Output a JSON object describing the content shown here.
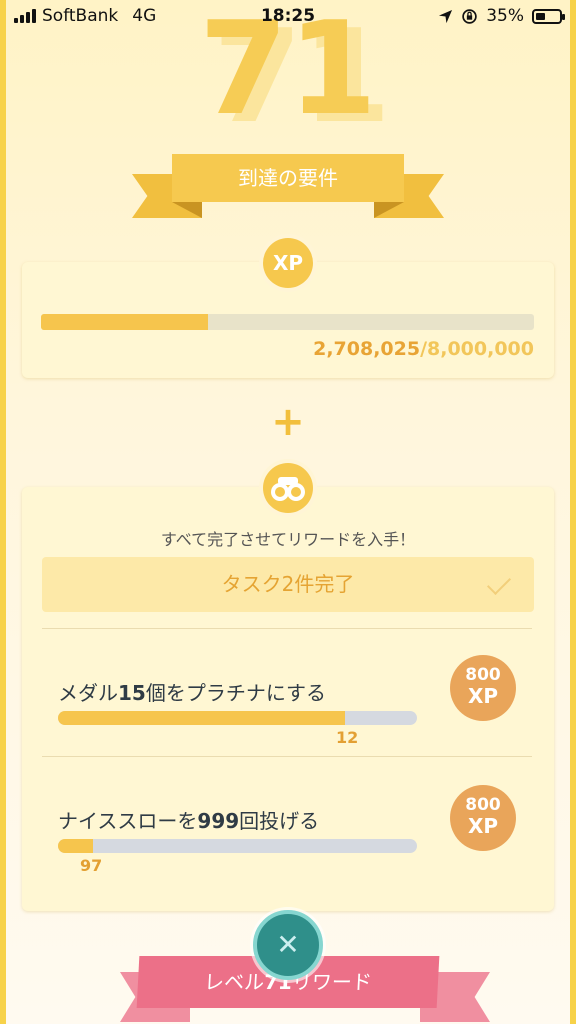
{
  "status_bar": {
    "carrier": "SoftBank",
    "network": "4G",
    "time": "18:25",
    "battery": "35%"
  },
  "level": "71",
  "ribbon_title": "到達の要件",
  "xp": {
    "badge": "XP",
    "current": "2,708,025",
    "max": "/8,000,000",
    "progress_fraction": 0.3385
  },
  "plus": "+",
  "tasks": {
    "intro": "すべて完了させてリワードを入手！",
    "summary": "タスク2件完了",
    "items": [
      {
        "title_pre": "メダル",
        "title_num": "15",
        "title_post": "個をプラチナにする",
        "count": "12",
        "progress_fraction": 0.8,
        "reward_num": "800",
        "reward_unit": "XP"
      },
      {
        "title_pre": "ナイススローを",
        "title_num": "999",
        "title_post": "回投げる",
        "count": "97",
        "progress_fraction": 0.097,
        "reward_num": "800",
        "reward_unit": "XP"
      }
    ]
  },
  "bottom_ribbon": {
    "pre": "レベル",
    "num": "71",
    "post": "リワード"
  },
  "colors": {
    "accent_yellow": "#f6c84d",
    "progress_orange": "#e8a435",
    "reward_orange": "#e9a55a",
    "ribbon_pink": "#ec7088",
    "close_teal": "#2f8f8a"
  }
}
